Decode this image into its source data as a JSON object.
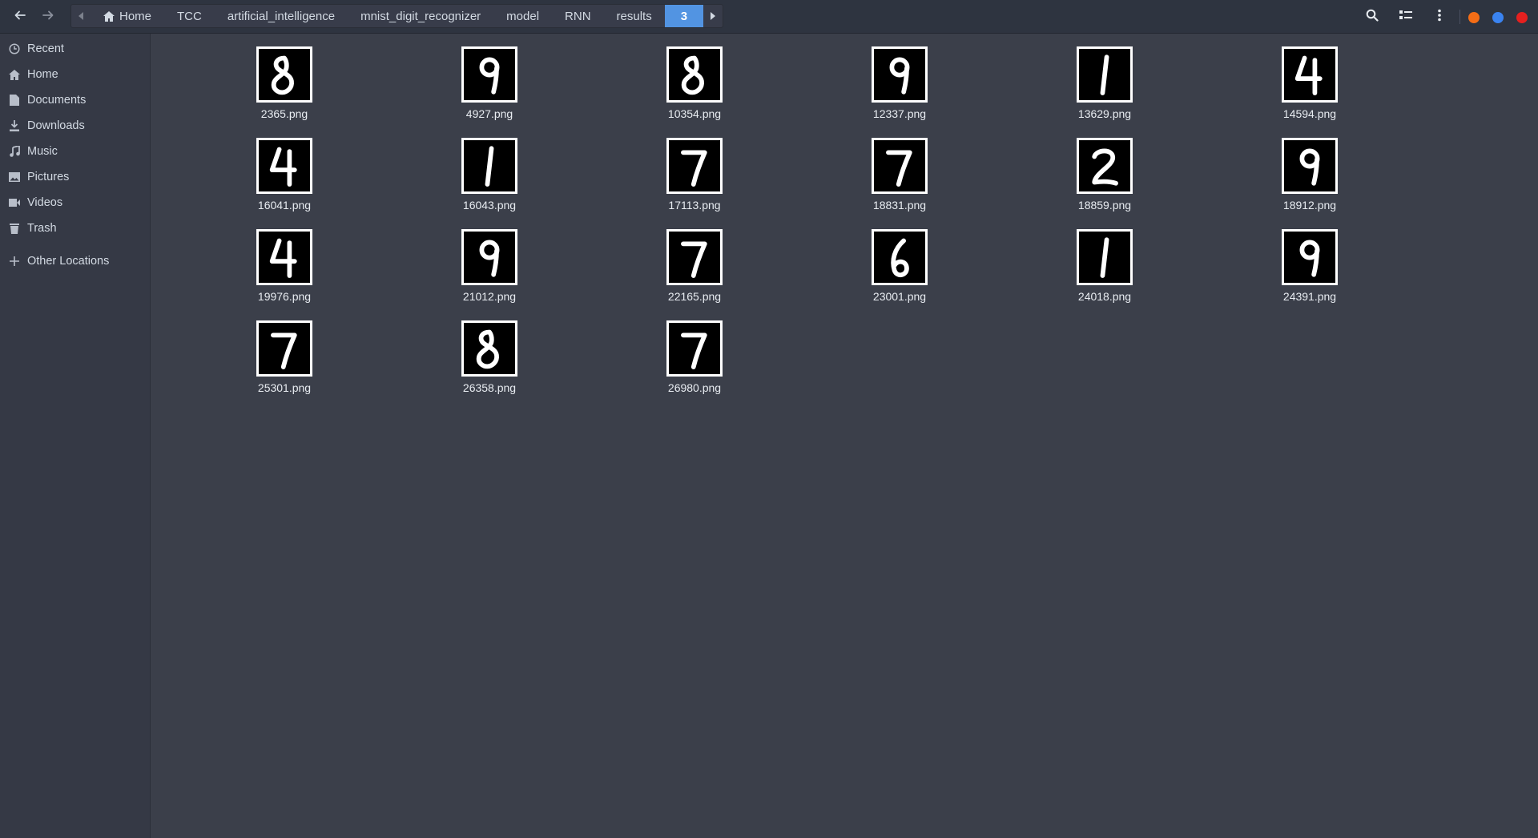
{
  "window": {
    "accent": "#5294e2",
    "controls": [
      {
        "name": "minimize",
        "color": "#f46d16"
      },
      {
        "name": "maximize",
        "color": "#3a83f0"
      },
      {
        "name": "close",
        "color": "#e5201f"
      }
    ]
  },
  "header": {
    "back_icon": "arrow-left-icon",
    "forward_icon": "arrow-right-icon",
    "breadcrumbs": [
      "Home",
      "TCC",
      "artificial_intelligence",
      "mnist_digit_recognizer",
      "model",
      "RNN",
      "results",
      "3"
    ],
    "tools": [
      "search-icon",
      "view-options-icon",
      "menu-icon"
    ]
  },
  "sidebar": {
    "items": [
      {
        "label": "Recent",
        "icon": "clock-icon"
      },
      {
        "label": "Home",
        "icon": "home-icon"
      },
      {
        "label": "Documents",
        "icon": "document-icon"
      },
      {
        "label": "Downloads",
        "icon": "download-icon"
      },
      {
        "label": "Music",
        "icon": "music-icon"
      },
      {
        "label": "Pictures",
        "icon": "picture-icon"
      },
      {
        "label": "Videos",
        "icon": "video-icon"
      },
      {
        "label": "Trash",
        "icon": "trash-icon"
      }
    ],
    "other": {
      "label": "Other Locations",
      "icon": "plus-icon"
    }
  },
  "files": [
    {
      "name": "2365.png",
      "digit": "8"
    },
    {
      "name": "4927.png",
      "digit": "9"
    },
    {
      "name": "10354.png",
      "digit": "8"
    },
    {
      "name": "12337.png",
      "digit": "9"
    },
    {
      "name": "13629.png",
      "digit": "1"
    },
    {
      "name": "14594.png",
      "digit": "4"
    },
    {
      "name": "16041.png",
      "digit": "4"
    },
    {
      "name": "16043.png",
      "digit": "1"
    },
    {
      "name": "17113.png",
      "digit": "7"
    },
    {
      "name": "18831.png",
      "digit": "7"
    },
    {
      "name": "18859.png",
      "digit": "2"
    },
    {
      "name": "18912.png",
      "digit": "9"
    },
    {
      "name": "19976.png",
      "digit": "4"
    },
    {
      "name": "21012.png",
      "digit": "9"
    },
    {
      "name": "22165.png",
      "digit": "7"
    },
    {
      "name": "23001.png",
      "digit": "6"
    },
    {
      "name": "24018.png",
      "digit": "1"
    },
    {
      "name": "24391.png",
      "digit": "9"
    },
    {
      "name": "25301.png",
      "digit": "7"
    },
    {
      "name": "26358.png",
      "digit": "8"
    },
    {
      "name": "26980.png",
      "digit": "7"
    }
  ]
}
